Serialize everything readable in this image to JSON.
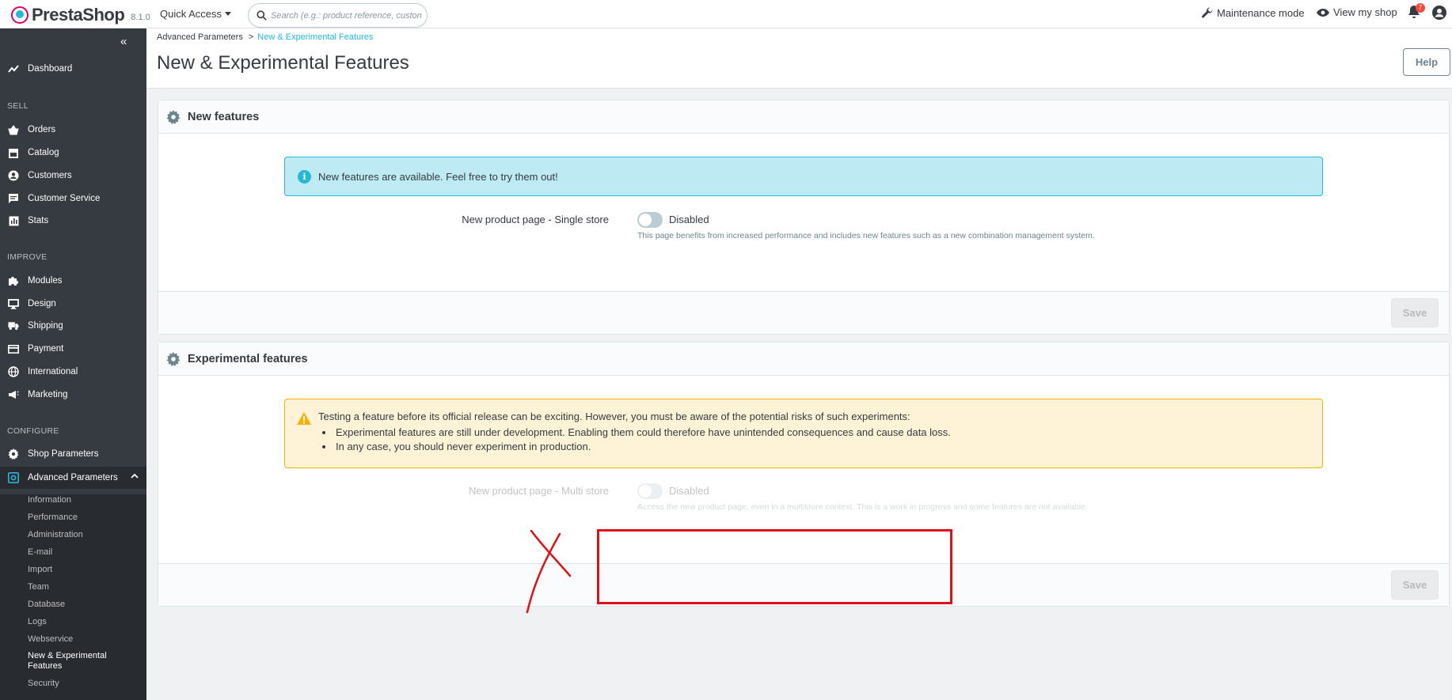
{
  "header": {
    "logo_brand": "PrestaShop",
    "version": "8.1.0",
    "quick_access": "Quick Access",
    "search_placeholder": "Search (e.g.: product reference, custon",
    "maintenance": "Maintenance mode",
    "view_shop": "View my shop",
    "notifications_count": "7"
  },
  "sidebar": {
    "dashboard": "Dashboard",
    "section_sell": "SELL",
    "orders": "Orders",
    "catalog": "Catalog",
    "customers": "Customers",
    "customer_service": "Customer Service",
    "stats": "Stats",
    "section_improve": "IMPROVE",
    "modules": "Modules",
    "design": "Design",
    "shipping": "Shipping",
    "payment": "Payment",
    "international": "International",
    "marketing": "Marketing",
    "section_configure": "CONFIGURE",
    "shop_parameters": "Shop Parameters",
    "advanced_parameters": "Advanced Parameters",
    "sub": {
      "information": "Information",
      "performance": "Performance",
      "administration": "Administration",
      "email": "E-mail",
      "import": "Import",
      "team": "Team",
      "database": "Database",
      "logs": "Logs",
      "webservice": "Webservice",
      "new_experimental": "New & Experimental Features",
      "security": "Security"
    }
  },
  "toolbar": {
    "breadcrumb_parent": "Advanced Parameters",
    "breadcrumb_sep": ">",
    "breadcrumb_current": "New & Experimental Features",
    "title": "New & Experimental Features",
    "help": "Help"
  },
  "new_features": {
    "title": "New features",
    "alert": "New features are available. Feel free to try them out!",
    "field_label": "New product page - Single store",
    "switch_state": "Disabled",
    "help": "This page benefits from increased performance and includes new features such as a new combination management system.",
    "save": "Save"
  },
  "experimental_features": {
    "title": "Experimental features",
    "warning_intro": "Testing a feature before its official release can be exciting. However, you must be aware of the potential risks of such experiments:",
    "warning_items": [
      "Experimental features are still under development. Enabling them could therefore have unintended consequences and cause data loss.",
      "In any case, you should never experiment in production."
    ],
    "field_label": "New product page - Multi store",
    "switch_state": "Disabled",
    "help": "Access the new product page, even in a multistore context. This is a work in progress and some features are not available.",
    "save": "Save"
  },
  "colors": {
    "accent": "#25b9d7",
    "brand": "#df0067",
    "sidebar": "#363a41",
    "annotation": "#e0101a"
  }
}
